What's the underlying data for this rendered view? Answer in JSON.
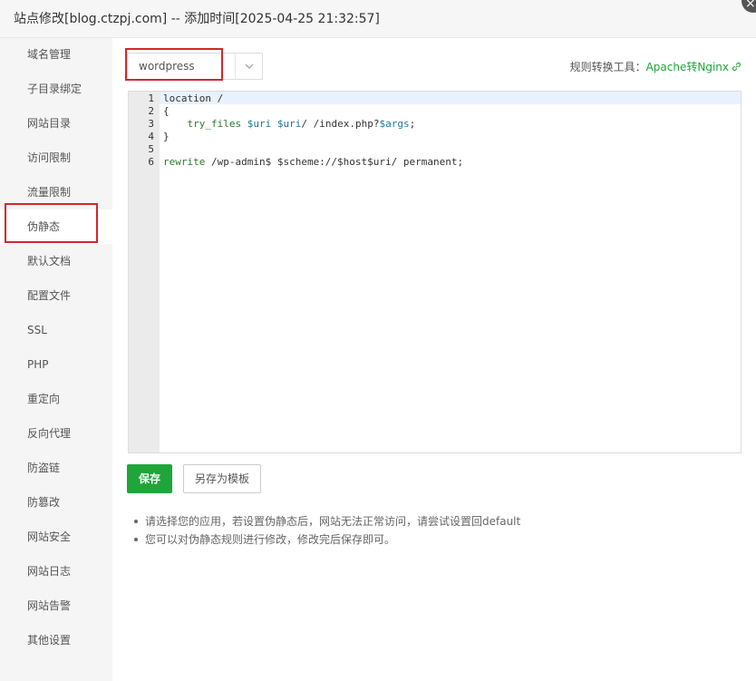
{
  "window": {
    "title": "站点修改[blog.ctzpj.com] -- 添加时间[2025-04-25 21:32:57]",
    "close_glyph": "×"
  },
  "sidebar": {
    "items": [
      {
        "label": "域名管理"
      },
      {
        "label": "子目录绑定"
      },
      {
        "label": "网站目录"
      },
      {
        "label": "访问限制"
      },
      {
        "label": "流量限制"
      },
      {
        "label": "伪静态",
        "active": true
      },
      {
        "label": "默认文档"
      },
      {
        "label": "配置文件"
      },
      {
        "label": "SSL"
      },
      {
        "label": "PHP"
      },
      {
        "label": "重定向"
      },
      {
        "label": "反向代理"
      },
      {
        "label": "防盗链"
      },
      {
        "label": "防篡改"
      },
      {
        "label": "网站安全"
      },
      {
        "label": "网站日志"
      },
      {
        "label": "网站告警"
      },
      {
        "label": "其他设置"
      }
    ]
  },
  "rewrite": {
    "selected_template": "wordpress",
    "convert_tool_label": "规则转换工具：",
    "convert_tool_link": "Apache转Nginx",
    "line_numbers": [
      "1",
      "2",
      "3",
      "4",
      "5",
      "6"
    ],
    "code": {
      "l1": "location /",
      "l2": "{",
      "l3_kw": "try_files",
      "l3_v1": "$uri",
      "l3_v2": "$uri",
      "l3_mid": "/ /index.php?",
      "l3_v3": "$args",
      "l3_end": ";",
      "l4": "}",
      "l5": "",
      "l6_kw": "rewrite",
      "l6_rest": " /wp-admin$ $scheme://$host$uri/ permanent;"
    },
    "save_label": "保存",
    "save_as_template_label": "另存为模板",
    "tips": [
      "请选择您的应用，若设置伪静态后，网站无法正常访问，请尝试设置回default",
      "您可以对伪静态规则进行修改，修改完后保存即可。"
    ]
  },
  "colors": {
    "accent_green": "#20a53a",
    "highlight_red": "#d0282c"
  }
}
